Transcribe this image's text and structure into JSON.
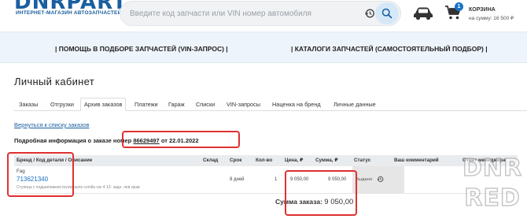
{
  "header": {
    "logo": "DNRPART",
    "logo_sub": "ИНТЕРНЕТ-МАГАЗИН АВТОЗАПЧАСТЕЙ",
    "search_placeholder": "Введите код запчасти или VIN номер автомобиля",
    "cart": {
      "badge": "1",
      "title": "КОРЗИНА",
      "sum": "на сумму: 16 500 ₽"
    }
  },
  "nav": {
    "left": "| ПОМОЩЬ В ПОДБОРЕ ЗАПЧАСТЕЙ (VIN-ЗАПРОС) |",
    "right": "| КАТАЛОГИ ЗАПЧАСТЕЙ (САМОСТОЯТЕЛЬНЫЙ ПОДБОР) |"
  },
  "page": {
    "title": "Личный кабинет",
    "tabs": [
      {
        "label": "Заказы",
        "active": false
      },
      {
        "label": "Отгрузки",
        "active": false
      },
      {
        "label": "Архив заказов",
        "active": true
      },
      {
        "label": "Платежи",
        "active": false
      },
      {
        "label": "Гараж",
        "active": false
      },
      {
        "label": "Списки",
        "active": false
      },
      {
        "label": "VIN-запросы",
        "active": false
      },
      {
        "label": "Наценка на бренд",
        "active": false
      },
      {
        "label": "Личные данные",
        "active": false
      }
    ],
    "back_link": "Вернуться к списку заказов",
    "order_info_prefix": "Подробная информация о заказе номер",
    "order_number": "86629497",
    "order_info_suffix": "от 22.01.2022"
  },
  "table": {
    "headers": {
      "brand": "Бренд / Код детали / Описание",
      "stock": "Склад",
      "term": "Срок",
      "qty": "Кол-во",
      "price": "Цена, ₽",
      "sum": "Сумма, ₽",
      "status": "Статус",
      "comment": "Ваш комментарий",
      "manager": "Ответ менеджера"
    },
    "row": {
      "brand": "Fag",
      "part": "713621340",
      "description": "Ступица с подшипником toyota auris corolla rav 4 12- задн. лев прав",
      "stock": "",
      "term": "8 дней",
      "qty": "1",
      "price": "9 050,00",
      "sum": "9 050,00",
      "status": "Выдано"
    },
    "total_label": "Сумма заказа:",
    "total_value": "9 050,00"
  },
  "watermark": {
    "line1": "DNR",
    "line2": "RED"
  },
  "colors": {
    "accent": "#1a5fa0",
    "highlight": "#e03131",
    "nav_bg": "#eef4fb"
  }
}
